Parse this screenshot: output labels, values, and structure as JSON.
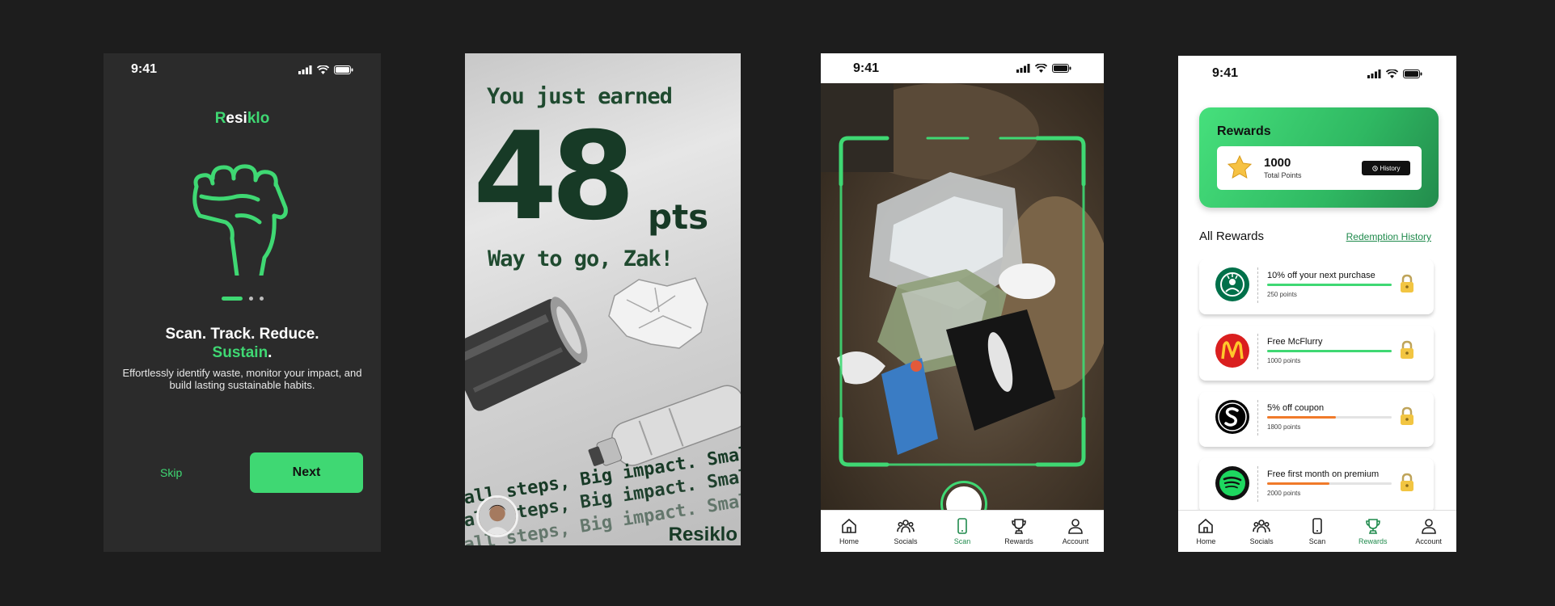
{
  "status_time": "9:41",
  "onboarding": {
    "logo_prefix": "R",
    "logo_mid": "esi",
    "logo_suffix": "klo",
    "headline_main": "Scan. Track. Reduce.",
    "headline_green": "Sustain",
    "headline_dot": ".",
    "description": "Effortlessly identify waste, monitor your impact, and build lasting sustainable habits.",
    "skip_label": "Skip",
    "next_label": "Next",
    "page_indicator": {
      "total": 3,
      "current": 1
    }
  },
  "celebration": {
    "earned_text": "You just earned",
    "points": "48",
    "points_unit": "pts",
    "greeting": "Way to go, Zak!",
    "banner_text": "Small steps, Big impact. Small steps, Big impact.",
    "brand": "Resiklo"
  },
  "scan": {
    "tabs": [
      {
        "label": "Home",
        "icon": "home-icon"
      },
      {
        "label": "Socials",
        "icon": "people-icon"
      },
      {
        "label": "Scan",
        "icon": "phone-icon"
      },
      {
        "label": "Rewards",
        "icon": "trophy-icon"
      },
      {
        "label": "Account",
        "icon": "user-icon"
      }
    ],
    "active_tab": "Scan"
  },
  "rewards": {
    "card_title": "Rewards",
    "total_points": "1000",
    "total_points_label": "Total Points",
    "history_label": "History",
    "all_rewards_label": "All Rewards",
    "redemption_history_label": "Redemption History",
    "items": [
      {
        "title": "10% off your next purchase",
        "points": "250 points",
        "progress": 1.0,
        "bar_color": "#3fd873",
        "brand_color": "#00704a"
      },
      {
        "title": "Free McFlurry",
        "points": "1000 points",
        "progress": 1.0,
        "bar_color": "#3fd873",
        "brand_color": "#da1f1f"
      },
      {
        "title": "5% off coupon",
        "points": "1800 points",
        "progress": 0.55,
        "bar_color": "#f07a2a",
        "brand_color": "#000000"
      },
      {
        "title": "Free first month on premium",
        "points": "2000 points",
        "progress": 0.5,
        "bar_color": "#f07a2a",
        "brand_color": "#111111"
      }
    ],
    "active_tab": "Rewards"
  },
  "colors": {
    "accent": "#3fd873",
    "dark_green": "#173a26",
    "orange": "#f07a2a"
  }
}
